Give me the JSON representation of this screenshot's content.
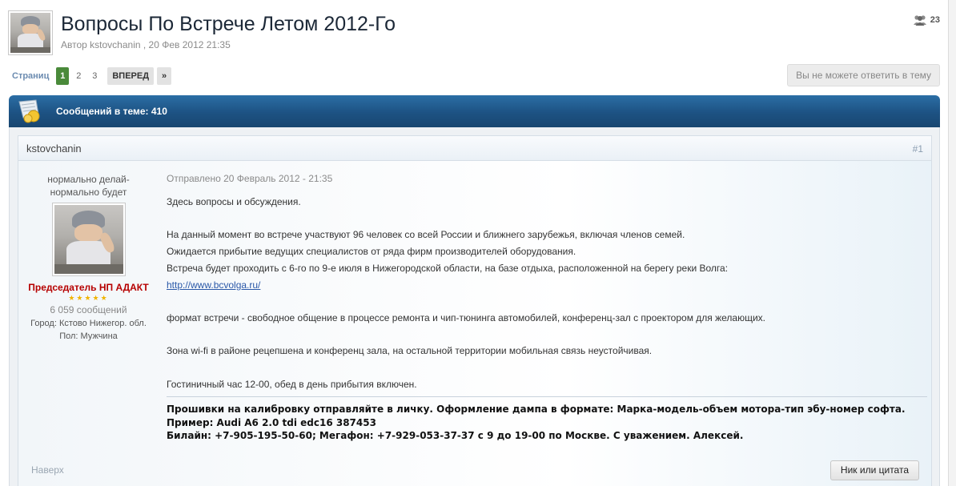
{
  "topic": {
    "title": "Вопросы По Встрече Летом 2012-Го",
    "meta": "Автор kstovchanin , 20 Фев 2012 21:35",
    "viewers_count": "23"
  },
  "pagination": {
    "label": "Страниц",
    "current": "1",
    "pages": [
      "2",
      "3"
    ],
    "next_label": "ВПЕРЕД",
    "last_label": "»"
  },
  "reply_button": "Вы не можете ответить в тему",
  "bar": {
    "count_text": "Сообщений в теме: 410"
  },
  "post": {
    "author": "kstovchanin",
    "number": "#1",
    "status_lines": [
      "нормально делай-",
      "нормально будет"
    ],
    "group": "Председатель НП АДАКТ",
    "stars": "★★★★★",
    "post_count": "6 059 сообщений",
    "fields": [
      {
        "key": "Город:",
        "value": "Кстово Нижегор. обл."
      },
      {
        "key": "Пол:",
        "value": "Мужчина"
      }
    ],
    "posted": "Отправлено 20 Февраль 2012 - 21:35",
    "lines": [
      "Здесь вопросы и обсуждения.",
      "",
      "На данный момент во встрече участвуют 96 человек со всей России и ближнего зарубежья, включая членов семей.",
      "Ожидается прибытие ведущих специалистов от ряда фирм производителей оборудования.",
      "Встреча будет проходить с 6-го по 9-е июля в Нижегородской области, на базе отдыха, расположенной на берегу реки Волга:"
    ],
    "link": "http://www.bcvolga.ru/",
    "lines2": [
      "",
      "формат встречи - свободное общение в процессе ремонта и чип-тюнинга автомобилей, конференц-зал с проектором для желающих.",
      "",
      "Зона wi-fi в районе рецепшена и конференц зала, на остальной территории мобильная связь неустойчивая.",
      "",
      "Гостиничный час 12-00, обед в день прибытия включен."
    ],
    "signature": [
      "Прошивки на калибровку отправляйте в личку. Оформление дампа в формате: Марка-модель-объем мотора-тип эбу-номер софта.",
      "Пример: Audi A6 2.0 tdi edc16 387453",
      "Билайн: +7-905-195-50-60; Мегафон: +7-929-053-37-37 с 9 до 19-00 по Москве. С уважением. Алексей."
    ],
    "back_to_top": "Наверх",
    "quote_button": "Ник или цитата"
  },
  "colors": {
    "bar_blue": "#1d5283",
    "current_page_green": "#4a8a3a",
    "group_red": "#b60000",
    "link_blue": "#2a58a8"
  }
}
